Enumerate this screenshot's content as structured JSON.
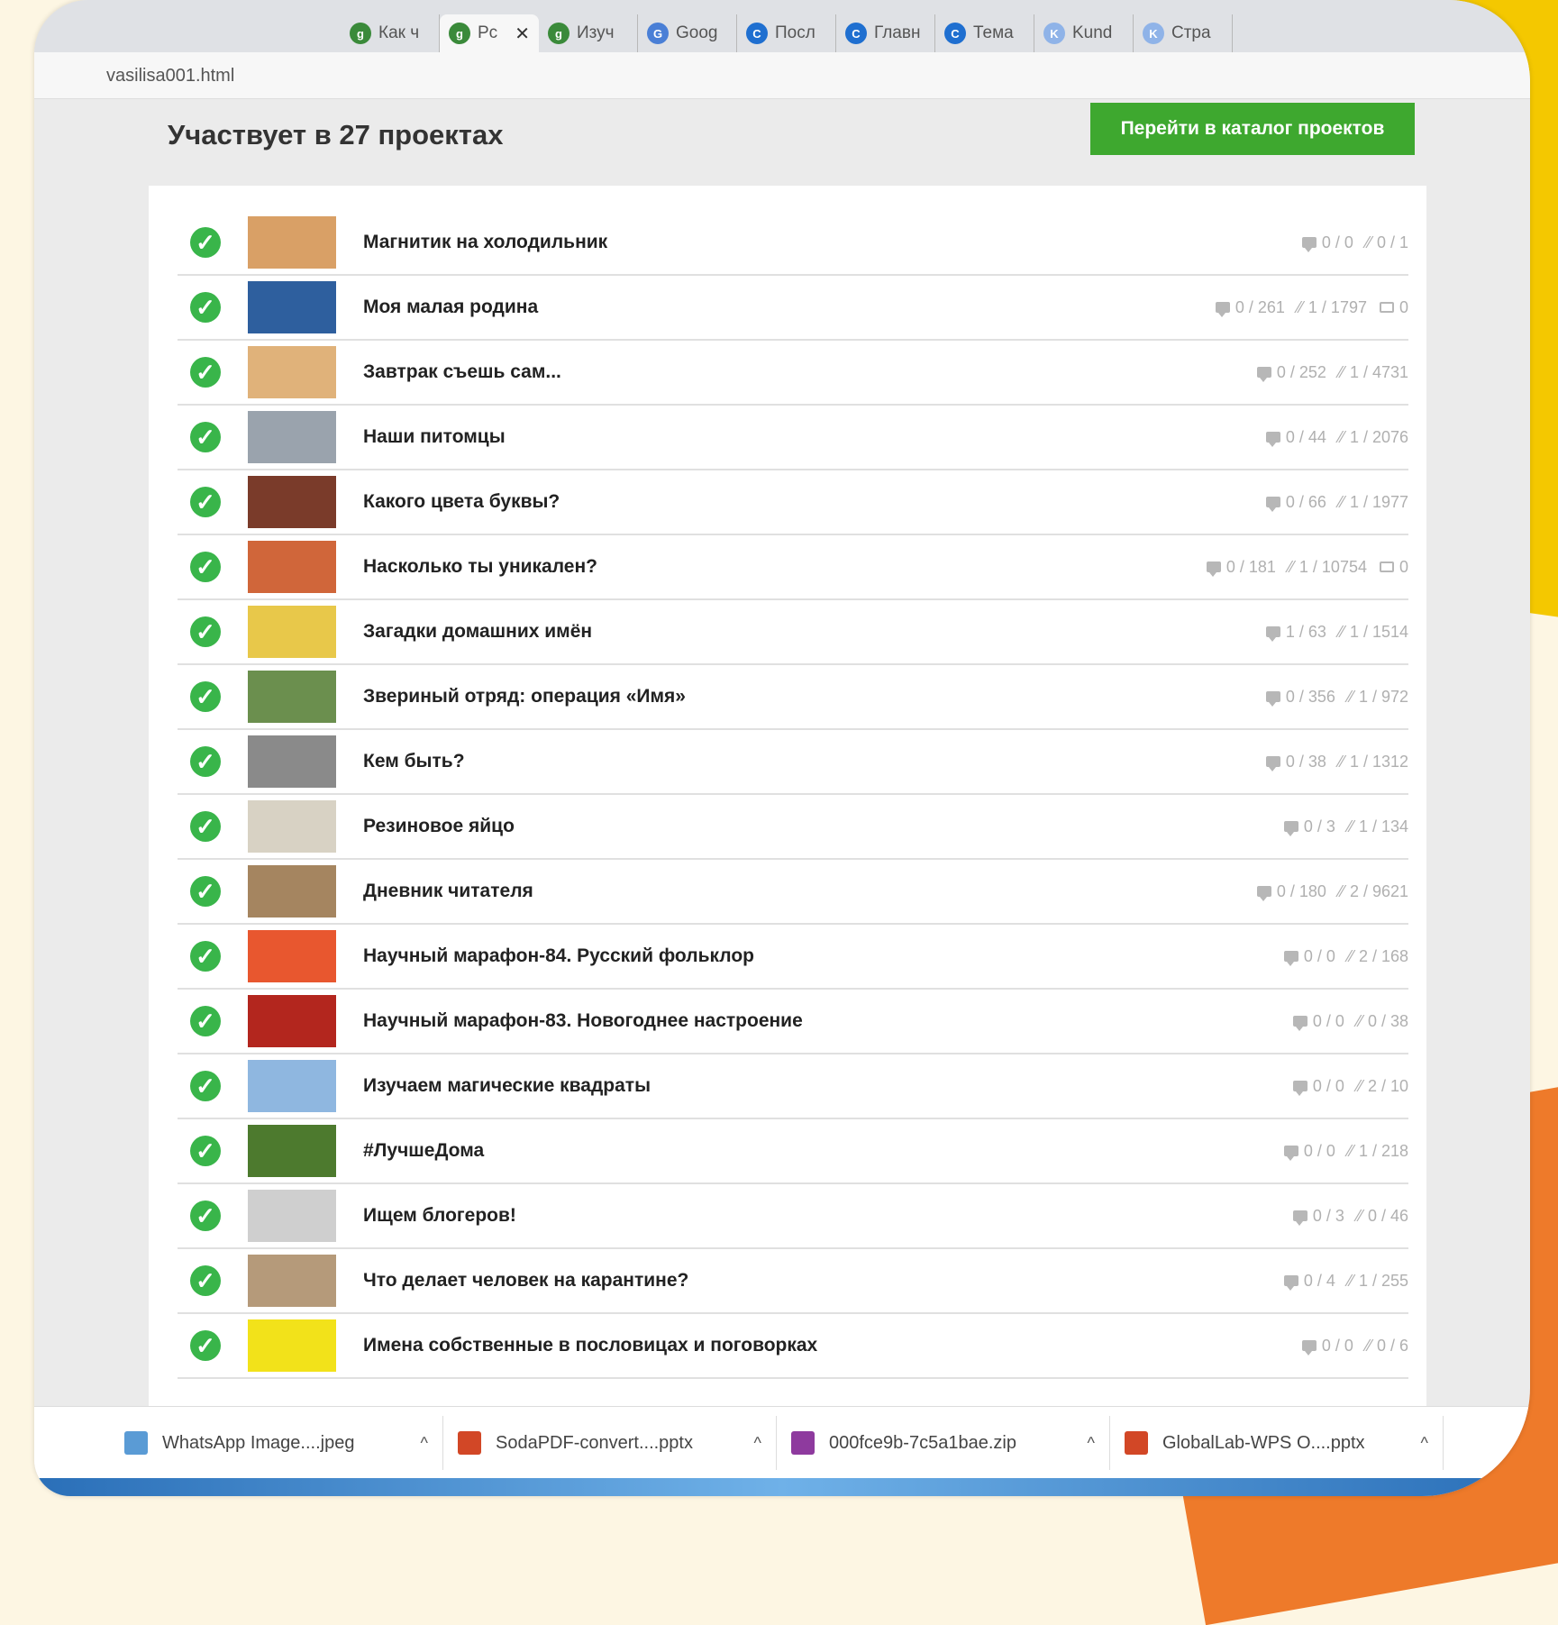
{
  "tabs": [
    {
      "label": "Как ч",
      "icon": "globallab-icon",
      "active": false
    },
    {
      "label": "Рс",
      "icon": "globallab-icon",
      "active": true
    },
    {
      "label": "Изуч",
      "icon": "globallab-icon",
      "active": false
    },
    {
      "label": "Goog",
      "icon": "google-translate-icon",
      "active": false
    },
    {
      "label": "Посл",
      "icon": "c-icon",
      "active": false
    },
    {
      "label": "Главн",
      "icon": "c-icon",
      "active": false
    },
    {
      "label": "Тема",
      "icon": "c-icon",
      "active": false
    },
    {
      "label": "Kund",
      "icon": "kundelik-icon",
      "active": false
    },
    {
      "label": "Стра",
      "icon": "kundelik-icon",
      "active": false
    }
  ],
  "address": "vasilisa001.html",
  "header": {
    "title": "Участвует в 27 проектах",
    "catalog_button": "Перейти в каталог проектов"
  },
  "colors": {
    "accent_green": "#3ea82f",
    "check_green": "#39b54a"
  },
  "projects": [
    {
      "title": "Магнитик на холодильник",
      "comments": "0 / 0",
      "trend": "0 / 1",
      "screens": null,
      "thumb": "#d9a066"
    },
    {
      "title": "Моя малая родина",
      "comments": "0 / 261",
      "trend": "1 / 1797",
      "screens": "0",
      "thumb": "#2e5f9e"
    },
    {
      "title": "Завтрак съешь сам...",
      "comments": "0 / 252",
      "trend": "1 / 4731",
      "screens": null,
      "thumb": "#e0b27a"
    },
    {
      "title": "Наши питомцы",
      "comments": "0 / 44",
      "trend": "1 / 2076",
      "screens": null,
      "thumb": "#9aa3ad"
    },
    {
      "title": "Какого цвета буквы?",
      "comments": "0 / 66",
      "trend": "1 / 1977",
      "screens": null,
      "thumb": "#7a3b2a"
    },
    {
      "title": "Насколько ты уникален?",
      "comments": "0 / 181",
      "trend": "1 / 10754",
      "screens": "0",
      "thumb": "#d0663a"
    },
    {
      "title": "Загадки домашних имён",
      "comments": "1 / 63",
      "trend": "1 / 1514",
      "screens": null,
      "thumb": "#e8c84a"
    },
    {
      "title": "Звериный отряд: операция «Имя»",
      "comments": "0 / 356",
      "trend": "1 / 972",
      "screens": null,
      "thumb": "#6b8f4e"
    },
    {
      "title": "Кем быть?",
      "comments": "0 / 38",
      "trend": "1 / 1312",
      "screens": null,
      "thumb": "#8a8a8a"
    },
    {
      "title": "Резиновое яйцо",
      "comments": "0 / 3",
      "trend": "1 / 134",
      "screens": null,
      "thumb": "#d8d2c4"
    },
    {
      "title": "Дневник читателя",
      "comments": "0 / 180",
      "trend": "2 / 9621",
      "screens": null,
      "thumb": "#a58560"
    },
    {
      "title": "Научный марафон-84. Русский фольклор",
      "comments": "0 / 0",
      "trend": "2 / 168",
      "screens": null,
      "thumb": "#e8572f"
    },
    {
      "title": "Научный марафон-83. Новогоднее настроение",
      "comments": "0 / 0",
      "trend": "0 / 38",
      "screens": null,
      "thumb": "#b3261e"
    },
    {
      "title": "Изучаем магические квадраты",
      "comments": "0 / 0",
      "trend": "2 / 10",
      "screens": null,
      "thumb": "#8fb7e0"
    },
    {
      "title": "#ЛучшеДома",
      "comments": "0 / 0",
      "trend": "1 / 218",
      "screens": null,
      "thumb": "#4d7a2e"
    },
    {
      "title": "Ищем блогеров!",
      "comments": "0 / 3",
      "trend": "0 / 46",
      "screens": null,
      "thumb": "#cfcfcf"
    },
    {
      "title": "Что делает человек на карантине?",
      "comments": "0 / 4",
      "trend": "1 / 255",
      "screens": null,
      "thumb": "#b59a7a"
    },
    {
      "title": "Имена собственные в пословицах и поговорках",
      "comments": "0 / 0",
      "trend": "0 / 6",
      "screens": null,
      "thumb": "#f2e21a"
    }
  ],
  "downloads": [
    {
      "label": "WhatsApp Image....jpeg",
      "icon": "image-file-icon",
      "color": "#5a9bd5"
    },
    {
      "label": "SodaPDF-convert....pptx",
      "icon": "pptx-file-icon",
      "color": "#d24726"
    },
    {
      "label": "000fce9b-7c5a1bae.zip",
      "icon": "zip-file-icon",
      "color": "#8e3a9e"
    },
    {
      "label": "GlobalLab-WPS O....pptx",
      "icon": "pptx-file-icon",
      "color": "#d24726"
    }
  ]
}
